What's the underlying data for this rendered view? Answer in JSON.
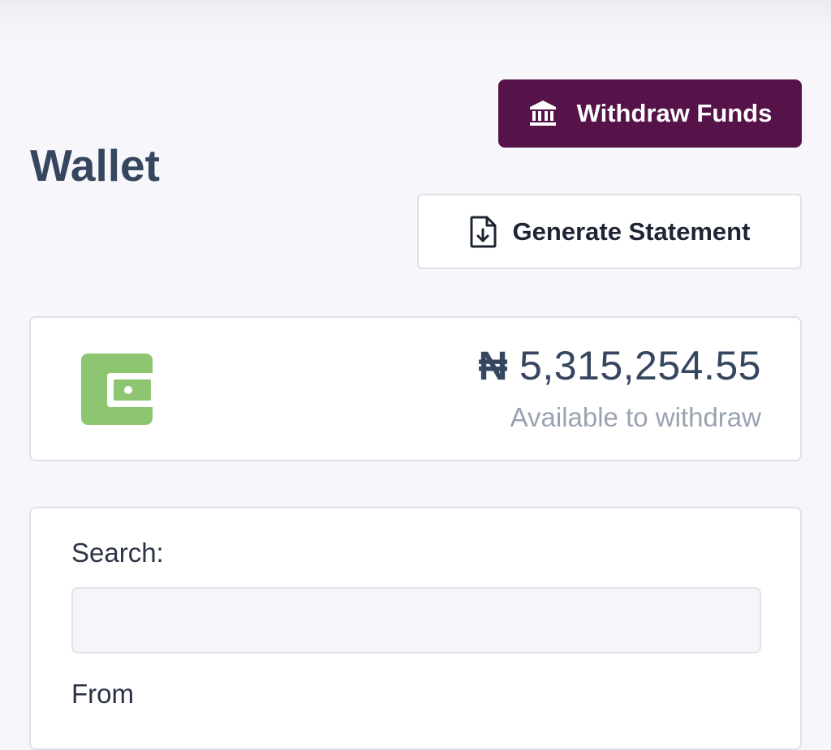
{
  "header": {
    "title": "Wallet",
    "withdraw_label": "Withdraw Funds",
    "withdraw_icon": "bank-icon",
    "statement_label": "Generate Statement",
    "statement_icon": "file-download-icon"
  },
  "balance": {
    "currency_symbol": "₦",
    "amount": "5,315,254.55",
    "caption": "Available to withdraw",
    "icon": "wallet-icon"
  },
  "filters": {
    "search_label": "Search:",
    "search_value": "",
    "from_label": "From"
  },
  "colors": {
    "primary": "#56134a",
    "wallet_green": "#8dc571",
    "title": "#35465e",
    "muted": "#9aa3b1"
  }
}
